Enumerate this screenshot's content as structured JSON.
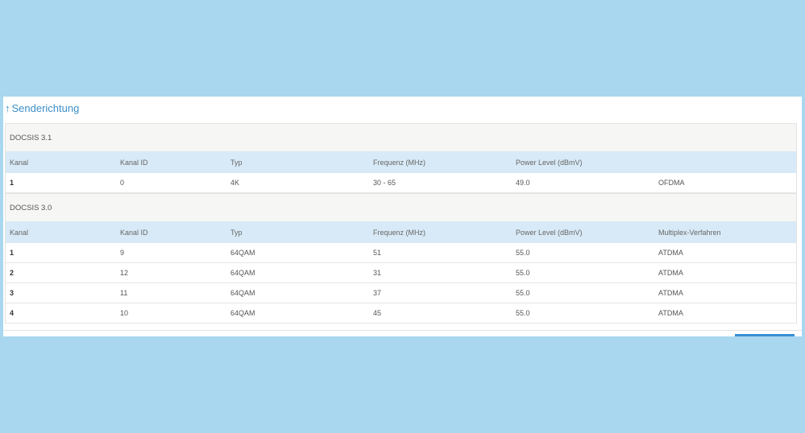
{
  "section": {
    "arrow": "↑",
    "title": "Senderichtung"
  },
  "docsis31": {
    "label": "DOCSIS 3.1",
    "headers": [
      "Kanal",
      "Kanal ID",
      "Typ",
      "Frequenz (MHz)",
      "Power Level (dBmV)",
      ""
    ],
    "rows": [
      [
        "1",
        "0",
        "4K",
        "30 - 65",
        "49.0",
        "OFDMA"
      ]
    ]
  },
  "docsis30": {
    "label": "DOCSIS 3.0",
    "headers": [
      "Kanal",
      "Kanal ID",
      "Typ",
      "Frequenz (MHz)",
      "Power Level (dBmV)",
      "Multiplex-Verfahren"
    ],
    "rows": [
      [
        "1",
        "9",
        "64QAM",
        "51",
        "55.0",
        "ATDMA"
      ],
      [
        "2",
        "12",
        "64QAM",
        "31",
        "55.0",
        "ATDMA"
      ],
      [
        "3",
        "11",
        "64QAM",
        "37",
        "55.0",
        "ATDMA"
      ],
      [
        "4",
        "10",
        "64QAM",
        "45",
        "55.0",
        "ATDMA"
      ]
    ]
  },
  "colors": {
    "background": "#a9d7ef",
    "accent": "#3b8fc6",
    "header_row": "#d8eaf7"
  }
}
